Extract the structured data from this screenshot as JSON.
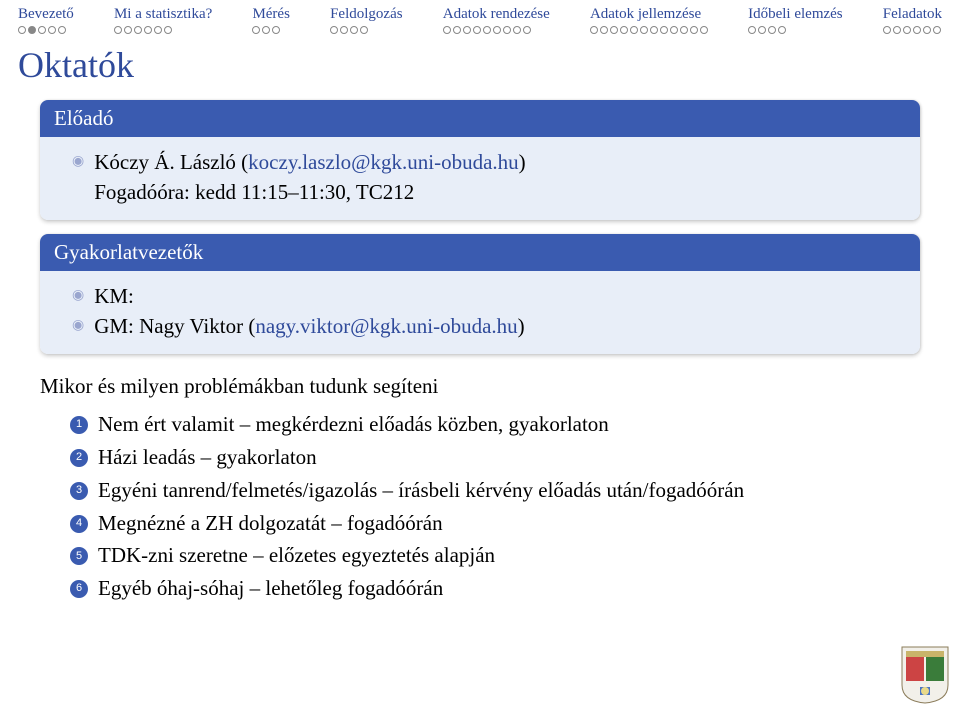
{
  "nav": [
    {
      "label": "Bevezető",
      "dots": 5,
      "filled": [
        1
      ]
    },
    {
      "label": "Mi a statisztika?",
      "dots": 6,
      "filled": []
    },
    {
      "label": "Mérés",
      "dots": 3,
      "filled": []
    },
    {
      "label": "Feldolgozás",
      "dots": 4,
      "filled": []
    },
    {
      "label": "Adatok rendezése",
      "dots": 9,
      "filled": []
    },
    {
      "label": "Adatok jellemzése",
      "dots": 12,
      "filled": []
    },
    {
      "label": "Időbeli elemzés",
      "dots": 4,
      "filled": []
    },
    {
      "label": "Feladatok",
      "dots": 6,
      "filled": []
    }
  ],
  "title": "Oktatók",
  "block1": {
    "header": "Előadó",
    "line1_name": "Kóczy Á. László (",
    "line1_email": "koczy.laszlo@kgk.uni-obuda.hu",
    "line1_close": ")",
    "line2": "Fogadóóra: kedd 11:15–11:30, TC212"
  },
  "block2": {
    "header": "Gyakorlatvezetők",
    "km": "KM:",
    "gm_prefix": "GM: Nagy Viktor (",
    "gm_email": "nagy.viktor@kgk.uni-obuda.hu",
    "gm_close": ")"
  },
  "afterText": "Mikor és milyen problémákban tudunk segíteni",
  "enum": [
    {
      "n": "1",
      "text": "Nem ért valamit – megkérdezni előadás közben, gyakorlaton"
    },
    {
      "n": "2",
      "text": "Házi leadás – gyakorlaton"
    },
    {
      "n": "3",
      "text": "Egyéni tanrend/felmetés/igazolás – írásbeli kérvény előadás után/fogadóórán"
    },
    {
      "n": "4",
      "text": "Megnézné a ZH dolgozatát – fogadóórán"
    },
    {
      "n": "5",
      "text": "TDK-zni szeretne – előzetes egyeztetés alapján"
    },
    {
      "n": "6",
      "text": "Egyéb óhaj-sóhaj – lehetőleg fogadóórán"
    }
  ]
}
